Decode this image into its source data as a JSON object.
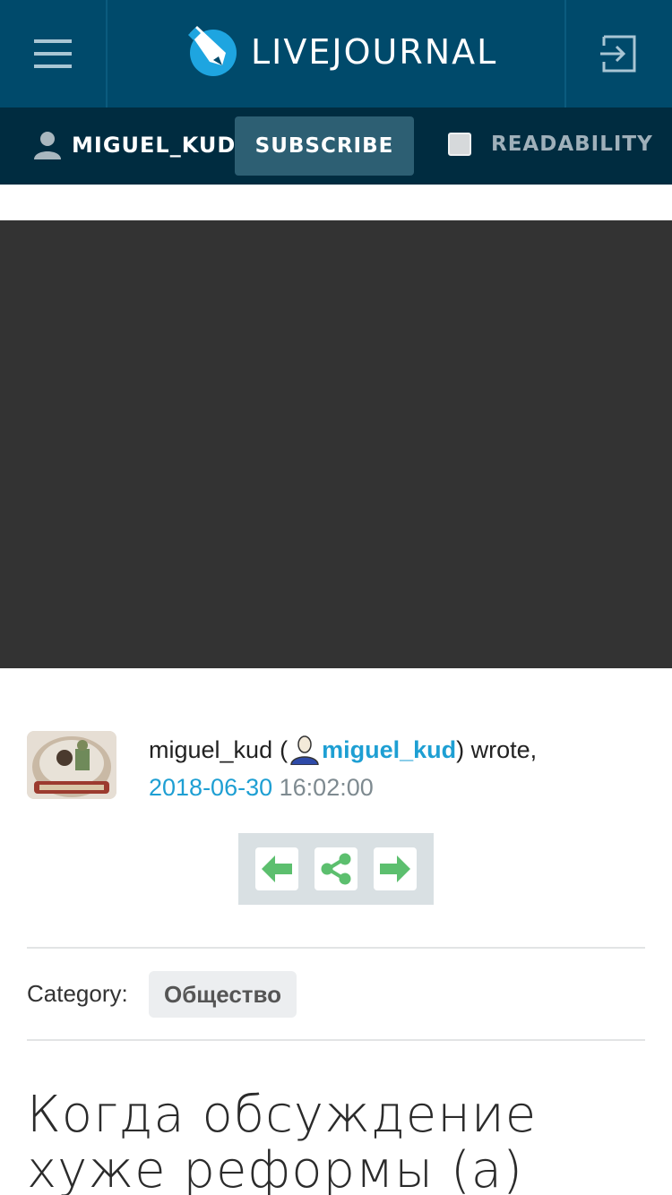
{
  "header": {
    "logo_text": "LIVEJOURNAL",
    "menu_icon": "hamburger-menu-icon",
    "login_icon": "login-icon"
  },
  "subbar": {
    "username": "MIGUEL_KUD",
    "subscribe_label": "SUBSCRIBE",
    "readability_label": "READABILITY",
    "readability_checked": false
  },
  "post": {
    "author": "miguel_kud",
    "open_paren": "(",
    "user_link": "miguel_kud",
    "wrote": ") wrote,",
    "date": "2018-06-30",
    "time": "16:02:00",
    "category_label": "Category:",
    "category": "Общество",
    "title": "Когда обсуждение хуже реформы (а)"
  },
  "colors": {
    "header_bg": "#004a6b",
    "subbar_bg": "#002c40",
    "subscribe_bg": "#2d5f73",
    "link": "#1e9fd3",
    "nav_arrow": "#5cbf6e",
    "ad_bg": "#333333"
  }
}
